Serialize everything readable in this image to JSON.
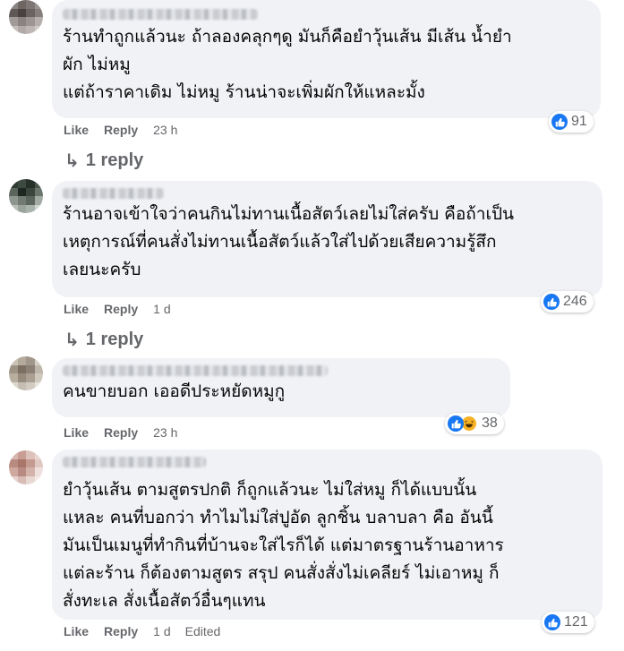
{
  "comments": [
    {
      "text": "ร้านทำถูกแล้วนะ ถ้าลองคลุกๆดู มันก็คือยำวุ้นเส้น มีเส้น น้ำยำ\nผัก ไม่หมู\nแต่ถ้าราคาเดิม ไม่หมู ร้านน่าจะเพิ่มผักให้แหละมั้ง",
      "reaction_count": "91",
      "like": "Like",
      "reply": "Reply",
      "time": "23 h",
      "replies_label": "1 reply"
    },
    {
      "text": "ร้านอาจเข้าใจว่าคนกินไม่ทานเนื้อสัตว์เลยไม่ใส่ครับ คือถ้าเป็น\nเหตุการณ์ที่คนสั่งไม่ทานเนื้อสัตว์แล้วใส่ไปด้วยเสียความรู้สึก\nเลยนะครับ",
      "reaction_count": "246",
      "like": "Like",
      "reply": "Reply",
      "time": "1 d",
      "replies_label": "1 reply"
    },
    {
      "text": "คนขายบอก เออดีประหยัดหมูกู",
      "reaction_count": "38",
      "like": "Like",
      "reply": "Reply",
      "time": "23 h"
    },
    {
      "text": "ยำวุ้นเส้น ตามสูตรปกติ ก็ถูกแล้วนะ ไม่ใส่หมู ก็ได้แบบนั้น\nแหละ คนที่บอกว่า ทำไมไม่ใส่ปูอัด ลูกชิ้น บลาบลา คือ อันนี้\nมันเป็นเมนูที่ทำกินที่บ้านจะใส่ไรก็ได้ แต่มาตรฐานร้านอาหาร\nแต่ละร้าน ก็ต้องตามสูตร สรุป คนสั่งสั่งไม่เคลียร์ ไม่เอาหมู ก็\nสั่งทะเล สั่งเนื้อสัตว์อื่นๆแทน",
      "reaction_count": "121",
      "like": "Like",
      "reply": "Reply",
      "time": "1 d",
      "edited": "Edited"
    }
  ],
  "colors": {
    "bubble": "#f0f2f5",
    "meta_text": "#65676b",
    "like_blue": "#1877f2",
    "haha_yellow": "#f7b125"
  },
  "icons": [
    "like-reaction-icon",
    "haha-reaction-icon",
    "reply-arrow-icon",
    "blurred-avatar"
  ]
}
